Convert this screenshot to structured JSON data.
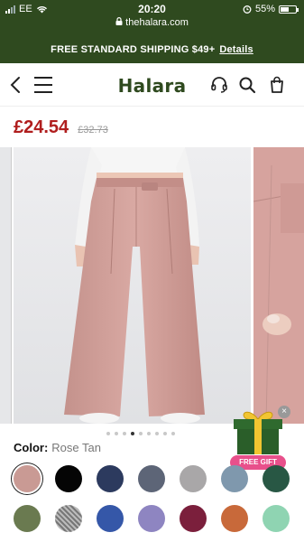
{
  "status": {
    "carrier": "EE",
    "time": "20:20",
    "url": "thehalara.com",
    "battery": "55%",
    "battery_level": 0.55
  },
  "banner": {
    "text": "FREE STANDARD SHIPPING $49+",
    "link": "Details"
  },
  "header": {
    "logo": "Halara"
  },
  "product": {
    "price": "£24.54",
    "old_price": "£32.73"
  },
  "gallery": {
    "dot_count": 9,
    "active_dot": 3
  },
  "gift": {
    "label": "FREE GIFT",
    "close": "×"
  },
  "colors": {
    "label": "Color:",
    "selected": "Rose Tan",
    "swatches": [
      {
        "name": "Rose Tan",
        "hex": "#c99a94"
      },
      {
        "name": "Black",
        "hex": "#050505"
      },
      {
        "name": "Navy",
        "hex": "#2c3a5e"
      },
      {
        "name": "Slate",
        "hex": "#5d6577"
      },
      {
        "name": "Light Grey",
        "hex": "#a9a7a8"
      },
      {
        "name": "Blue Grey",
        "hex": "#7f98ad"
      },
      {
        "name": "Dark Green",
        "hex": "#285744"
      },
      {
        "name": "Olive",
        "hex": "#6a7a50"
      },
      {
        "name": "Tweed",
        "hex": "#8e8e8e"
      },
      {
        "name": "Royal Blue",
        "hex": "#3557a8"
      },
      {
        "name": "Lavender",
        "hex": "#8e85c1"
      },
      {
        "name": "Burgundy",
        "hex": "#7b1f3c"
      },
      {
        "name": "Orange",
        "hex": "#c8693a"
      },
      {
        "name": "Mint",
        "hex": "#8fd4b2"
      }
    ]
  }
}
